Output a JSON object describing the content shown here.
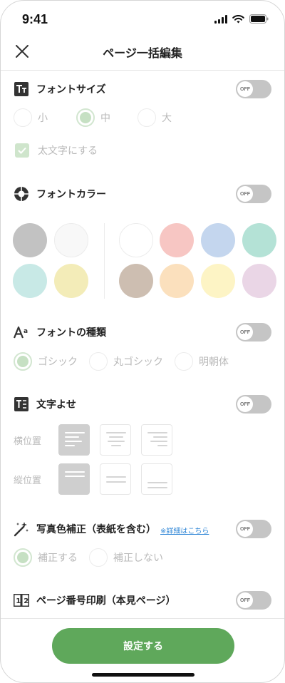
{
  "status_bar": {
    "time": "9:41"
  },
  "header": {
    "title": "ページ一括編集"
  },
  "font_size": {
    "title": "フォントサイズ",
    "toggle": "OFF",
    "options": [
      "小",
      "中",
      "大"
    ],
    "selected": "中",
    "bold_label": "太文字にする",
    "bold_checked": true
  },
  "font_color": {
    "title": "フォントカラー",
    "toggle": "OFF",
    "left_swatches": [
      "#c2c2c2",
      "#f8f8f8",
      "#c8e9e6",
      "#f3ecb8"
    ],
    "right_swatches": [
      "#ffffff",
      "#f7c6c3",
      "#c4d6ee",
      "#b4e2d6",
      "#cdbeb1",
      "#fbe0bd",
      "#fdf4c5",
      "#ead6e6"
    ]
  },
  "font_type": {
    "title": "フォントの種類",
    "toggle": "OFF",
    "options": [
      "ゴシック",
      "丸ゴシック",
      "明朝体"
    ],
    "selected": "ゴシック"
  },
  "text_align": {
    "title": "文字よせ",
    "toggle": "OFF",
    "horizontal_label": "横位置",
    "vertical_label": "縦位置",
    "horizontal_selected": "left",
    "vertical_selected": "top"
  },
  "photo_correction": {
    "title": "写真色補正（表紙を含む）",
    "link": "※詳細はこちら",
    "toggle": "OFF",
    "options": [
      "補正する",
      "補正しない"
    ],
    "selected": "補正する"
  },
  "page_number": {
    "title": "ページ番号印刷（本見ページ）",
    "toggle": "OFF"
  },
  "footer": {
    "submit_label": "設定する"
  },
  "colors": {
    "accent": "#5fa85b",
    "toggle_off": "#c5c5c5",
    "link": "#2f86d6"
  }
}
